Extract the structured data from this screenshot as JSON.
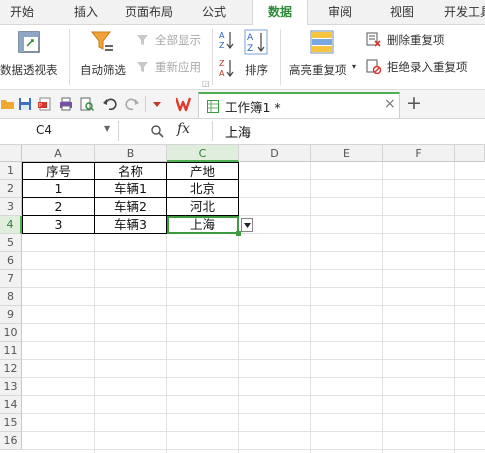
{
  "menu": {
    "tabs": [
      "开始",
      "插入",
      "页面布局",
      "公式",
      "数据",
      "审阅",
      "视图",
      "开发工具"
    ],
    "active_index": 4
  },
  "ribbon": {
    "pivot_label": "数据透视表",
    "autofilter_label": "自动筛选",
    "show_all_label": "全部显示",
    "reapply_label": "重新应用",
    "sort_label": "排序",
    "highlight_dup_label": "高亮重复项",
    "remove_dup_label": "删除重复项",
    "reject_dup_label": "拒绝录入重复项"
  },
  "quick_access": {
    "doc_tab_title": "工作簿1 *",
    "new_tab_symbol": "+",
    "close_symbol": "×"
  },
  "formula_bar": {
    "name_box": "C4",
    "fx_label": "fx",
    "content": "上海"
  },
  "sheet": {
    "columns": [
      "A",
      "B",
      "C",
      "D",
      "E",
      "F"
    ],
    "rows": [
      "1",
      "2",
      "3",
      "4",
      "5",
      "6",
      "7",
      "8",
      "9",
      "10",
      "11",
      "12",
      "13",
      "14",
      "15",
      "16"
    ],
    "selected_cell": "C4",
    "data": [
      [
        "序号",
        "名称",
        "产地"
      ],
      [
        "1",
        "车辆1",
        "北京"
      ],
      [
        "2",
        "车辆2",
        "河北"
      ],
      [
        "3",
        "车辆3",
        "上海"
      ]
    ]
  },
  "colors": {
    "accent": "#4caf50",
    "active_tab_text": "#2e8b3a",
    "wps_logo": "#e03a2f"
  }
}
